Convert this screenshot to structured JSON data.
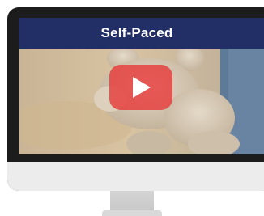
{
  "video_card": {
    "title": "Self-Paced",
    "play_icon": "play-icon",
    "colors": {
      "title_bar": "#222f66",
      "play_button": "#e63c3c"
    }
  }
}
